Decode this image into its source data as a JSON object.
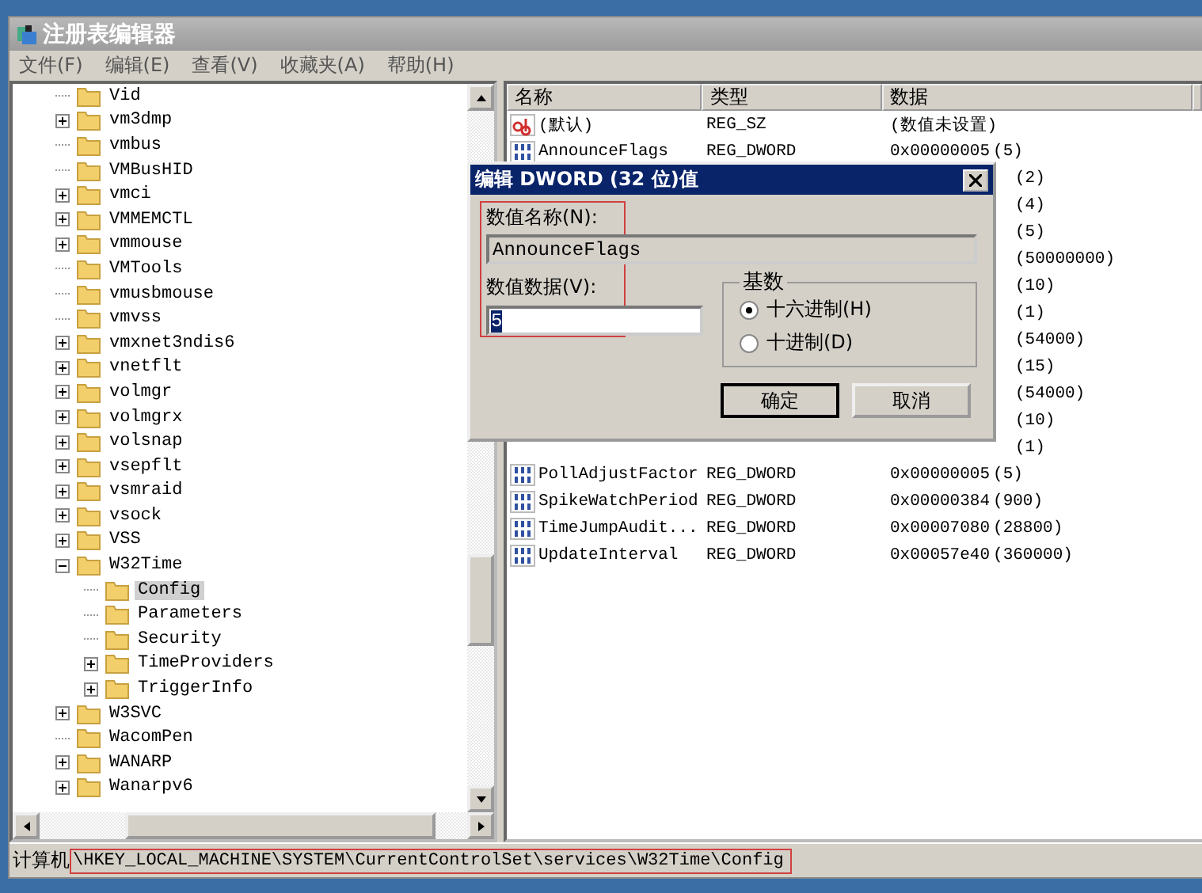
{
  "window": {
    "title": "注册表编辑器"
  },
  "menu": [
    "文件(F)",
    "编辑(E)",
    "查看(V)",
    "收藏夹(A)",
    "帮助(H)"
  ],
  "tree": {
    "items": [
      {
        "label": "Vid",
        "kind": "leaf",
        "selected": false
      },
      {
        "label": "vm3dmp",
        "kind": "collapsed",
        "selected": false
      },
      {
        "label": "vmbus",
        "kind": "leaf",
        "selected": false
      },
      {
        "label": "VMBusHID",
        "kind": "leaf",
        "selected": false
      },
      {
        "label": "vmci",
        "kind": "collapsed",
        "selected": false
      },
      {
        "label": "VMMEMCTL",
        "kind": "collapsed",
        "selected": false
      },
      {
        "label": "vmmouse",
        "kind": "collapsed",
        "selected": false
      },
      {
        "label": "VMTools",
        "kind": "leaf",
        "selected": false
      },
      {
        "label": "vmusbmouse",
        "kind": "leaf",
        "selected": false
      },
      {
        "label": "vmvss",
        "kind": "leaf",
        "selected": false
      },
      {
        "label": "vmxnet3ndis6",
        "kind": "collapsed",
        "selected": false
      },
      {
        "label": "vnetflt",
        "kind": "collapsed",
        "selected": false
      },
      {
        "label": "volmgr",
        "kind": "collapsed",
        "selected": false
      },
      {
        "label": "volmgrx",
        "kind": "collapsed",
        "selected": false
      },
      {
        "label": "volsnap",
        "kind": "collapsed",
        "selected": false
      },
      {
        "label": "vsepflt",
        "kind": "collapsed",
        "selected": false
      },
      {
        "label": "vsmraid",
        "kind": "collapsed",
        "selected": false
      },
      {
        "label": "vsock",
        "kind": "collapsed",
        "selected": false
      },
      {
        "label": "VSS",
        "kind": "collapsed",
        "selected": false
      },
      {
        "label": "W32Time",
        "kind": "expanded",
        "selected": false,
        "children": [
          {
            "label": "Config",
            "kind": "leaf",
            "selected": true
          },
          {
            "label": "Parameters",
            "kind": "leaf",
            "selected": false
          },
          {
            "label": "Security",
            "kind": "leaf",
            "selected": false
          },
          {
            "label": "TimeProviders",
            "kind": "collapsed",
            "selected": false
          },
          {
            "label": "TriggerInfo",
            "kind": "collapsed",
            "selected": false
          }
        ]
      },
      {
        "label": "W3SVC",
        "kind": "collapsed",
        "selected": false
      },
      {
        "label": "WacomPen",
        "kind": "leaf",
        "selected": false
      },
      {
        "label": "WANARP",
        "kind": "collapsed",
        "selected": false
      },
      {
        "label": "Wanarpv6",
        "kind": "collapsed",
        "selected": false
      }
    ]
  },
  "values": {
    "columns": [
      "名称",
      "类型",
      "数据"
    ],
    "rows": [
      {
        "kind": "string",
        "name": "(默认)",
        "type": "REG_SZ",
        "data": "(数值未设置)"
      },
      {
        "kind": "dword",
        "name": "AnnounceFlags",
        "type": "REG_DWORD",
        "data": "0x00000005",
        "decimal": "(5)"
      },
      {
        "kind": "hidden",
        "decimal": "(2)"
      },
      {
        "kind": "hidden",
        "decimal": "(4)"
      },
      {
        "kind": "hidden",
        "decimal": "(5)"
      },
      {
        "kind": "hidden",
        "decimal": "(50000000)"
      },
      {
        "kind": "hidden",
        "decimal": "(10)"
      },
      {
        "kind": "hidden",
        "decimal": "(1)"
      },
      {
        "kind": "hidden",
        "decimal": "(54000)"
      },
      {
        "kind": "hidden",
        "decimal": "(15)"
      },
      {
        "kind": "hidden",
        "decimal": "(54000)"
      },
      {
        "kind": "hidden",
        "decimal": "(10)"
      },
      {
        "kind": "hidden",
        "decimal": "(1)"
      },
      {
        "kind": "dword",
        "name": "PollAdjustFactor",
        "type": "REG_DWORD",
        "data": "0x00000005",
        "decimal": "(5)"
      },
      {
        "kind": "dword",
        "name": "SpikeWatchPeriod",
        "type": "REG_DWORD",
        "data": "0x00000384",
        "decimal": "(900)"
      },
      {
        "kind": "dword",
        "name": "TimeJumpAudit...",
        "type": "REG_DWORD",
        "data": "0x00007080",
        "decimal": "(28800)"
      },
      {
        "kind": "dword",
        "name": "UpdateInterval",
        "type": "REG_DWORD",
        "data": "0x00057e40",
        "decimal": "(360000)"
      }
    ]
  },
  "dialog": {
    "title": "编辑 DWORD (32 位)值",
    "name_label": "数值名称(N):",
    "name_value": "AnnounceFlags",
    "data_label": "数值数据(V):",
    "data_value": "5",
    "base": {
      "label": "基数",
      "options": [
        {
          "label": "十六进制(H)",
          "selected": true
        },
        {
          "label": "十进制(D)",
          "selected": false
        }
      ]
    },
    "buttons": [
      "确定",
      "取消"
    ]
  },
  "status_bar": {
    "prefix": "计算机",
    "path": "\\HKEY_LOCAL_MACHINE\\SYSTEM\\CurrentControlSet\\services\\W32Time\\Config"
  }
}
